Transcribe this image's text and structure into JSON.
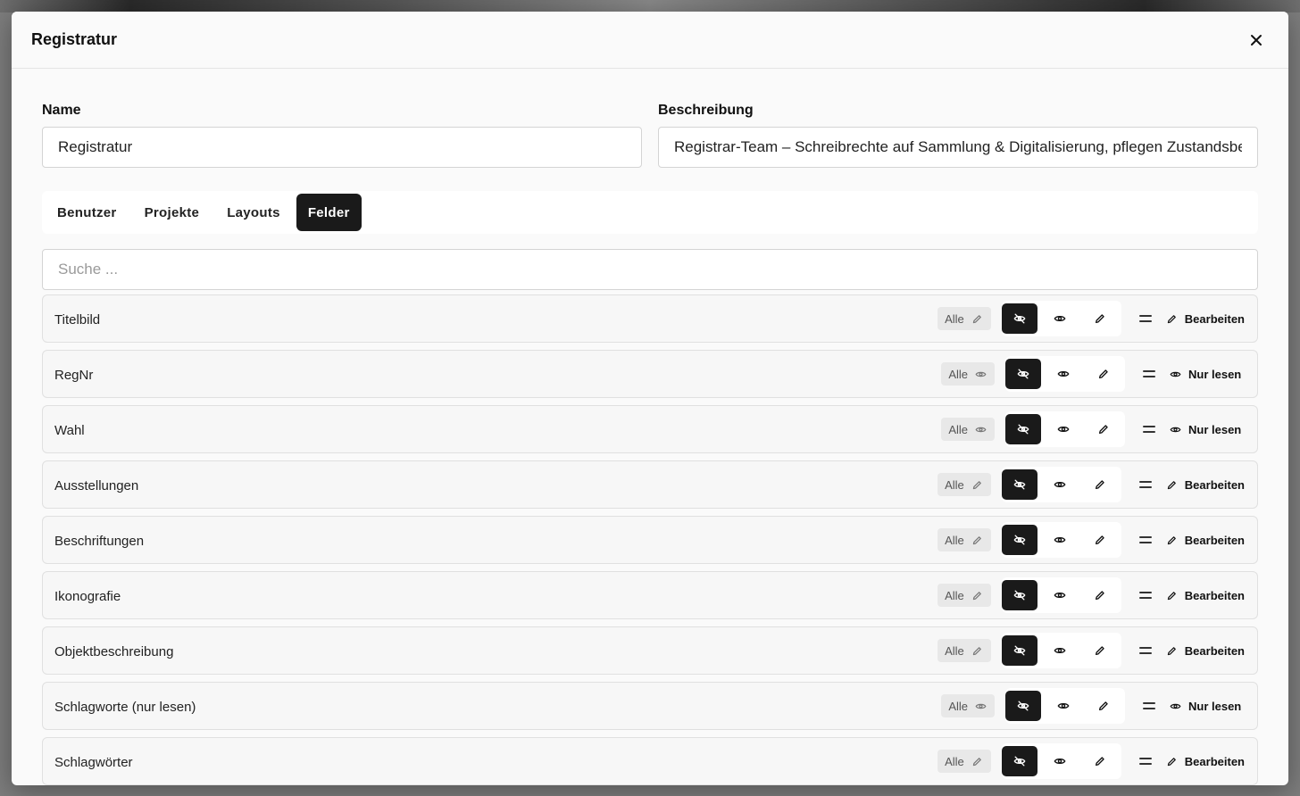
{
  "modal": {
    "title": "Registratur"
  },
  "form": {
    "name_label": "Name",
    "name_value": "Registratur",
    "description_label": "Beschreibung",
    "description_value": "Registrar-Team – Schreibrechte auf Sammlung & Digitalisierung, pflegen Zustandsberichte"
  },
  "tabs": [
    {
      "label": "Benutzer",
      "active": false
    },
    {
      "label": "Projekte",
      "active": false
    },
    {
      "label": "Layouts",
      "active": false
    },
    {
      "label": "Felder",
      "active": true
    }
  ],
  "search": {
    "placeholder": "Suche ..."
  },
  "fields": [
    {
      "label": "Titelbild",
      "badge": "Alle",
      "badge_icon": "pencil-icon",
      "result": "Bearbeiten",
      "result_icon": "pencil-icon"
    },
    {
      "label": "RegNr",
      "badge": "Alle",
      "badge_icon": "eye-icon",
      "result": "Nur lesen",
      "result_icon": "eye-icon"
    },
    {
      "label": "Wahl",
      "badge": "Alle",
      "badge_icon": "eye-icon",
      "result": "Nur lesen",
      "result_icon": "eye-icon"
    },
    {
      "label": "Ausstellungen",
      "badge": "Alle",
      "badge_icon": "pencil-icon",
      "result": "Bearbeiten",
      "result_icon": "pencil-icon"
    },
    {
      "label": "Beschriftungen",
      "badge": "Alle",
      "badge_icon": "pencil-icon",
      "result": "Bearbeiten",
      "result_icon": "pencil-icon"
    },
    {
      "label": "Ikonografie",
      "badge": "Alle",
      "badge_icon": "pencil-icon",
      "result": "Bearbeiten",
      "result_icon": "pencil-icon"
    },
    {
      "label": "Objektbeschreibung",
      "badge": "Alle",
      "badge_icon": "pencil-icon",
      "result": "Bearbeiten",
      "result_icon": "pencil-icon"
    },
    {
      "label": "Schlagworte (nur lesen)",
      "badge": "Alle",
      "badge_icon": "eye-icon",
      "result": "Nur lesen",
      "result_icon": "eye-icon"
    },
    {
      "label": "Schlagwörter",
      "badge": "Alle",
      "badge_icon": "pencil-icon",
      "result": "Bearbeiten",
      "result_icon": "pencil-icon"
    }
  ],
  "segment_icons": [
    "eye-off-icon",
    "eye-icon",
    "pencil-icon"
  ],
  "colors": {
    "active_dark": "#1a1a1a",
    "badge_bg": "#e8e8e8",
    "row_bg": "#f7f7f7"
  }
}
